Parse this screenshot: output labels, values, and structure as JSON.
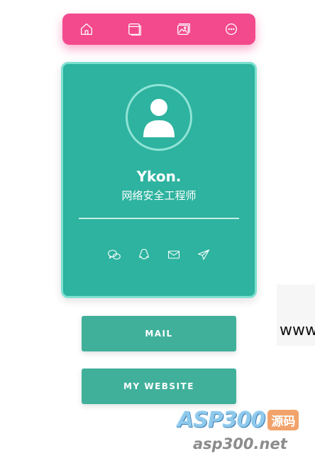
{
  "nav": {
    "icons": [
      "home-icon",
      "window-icon",
      "gallery-icon",
      "more-icon"
    ],
    "color": "#f34a8e"
  },
  "profile": {
    "name": "Ykon.",
    "title": "网络安全工程师",
    "card_color": "#2db39f",
    "social_icons": [
      "wechat-icon",
      "qq-icon",
      "mail-icon",
      "telegram-icon"
    ]
  },
  "buttons": {
    "mail_label": "MAIL",
    "website_label": "MY WEBSITE",
    "color": "#40b09b"
  },
  "side": {
    "text": "www"
  },
  "watermark": {
    "brand": "ASP300",
    "badge": "源码",
    "url": "asp300.net"
  }
}
